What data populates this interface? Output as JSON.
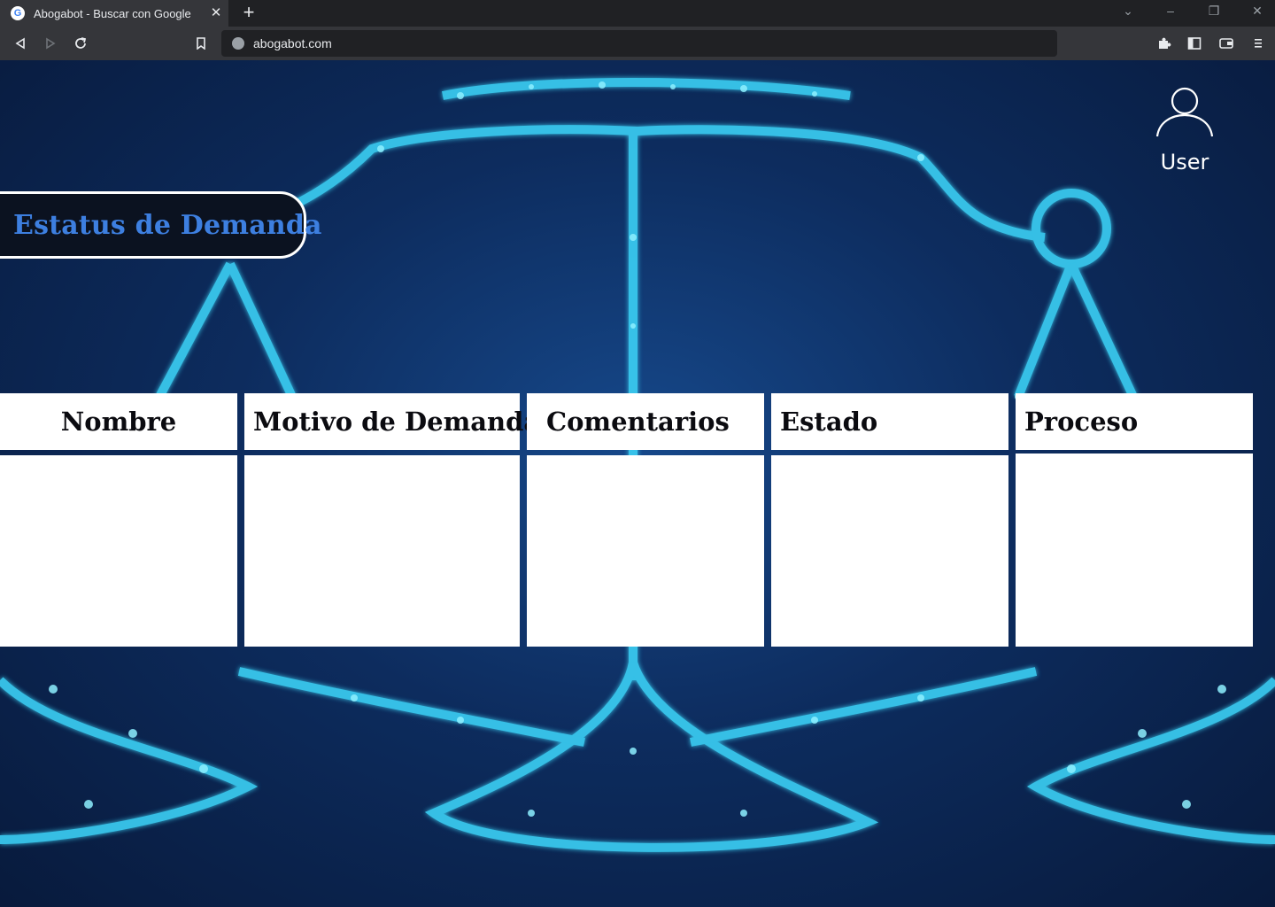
{
  "browser": {
    "tab_title": "Abogabot - Buscar con Google",
    "favicon_letter": "G",
    "url": "abogabot.com",
    "icons": {
      "tab_close": "close-icon",
      "new_tab": "plus-icon",
      "back": "back-icon",
      "forward": "forward-icon",
      "reload": "reload-icon",
      "bookmark": "bookmark-icon",
      "extensions": "puzzle-icon",
      "sidebar": "sidebar-icon",
      "wallet": "wallet-icon",
      "menu": "menu-icon"
    }
  },
  "header": {
    "user_label": "User",
    "user_icon": "user-icon"
  },
  "status": {
    "title": "Estatus de Demanda"
  },
  "table": {
    "columns": [
      {
        "label": "Nombre"
      },
      {
        "label": "Motivo de Demanda"
      },
      {
        "label": "Comentarios"
      },
      {
        "label": "Estado"
      },
      {
        "label": "Proceso"
      }
    ]
  },
  "colors": {
    "title_accent": "#3d7fe0",
    "background_dark": "#081a3c",
    "glow": "#3ad0f5"
  }
}
